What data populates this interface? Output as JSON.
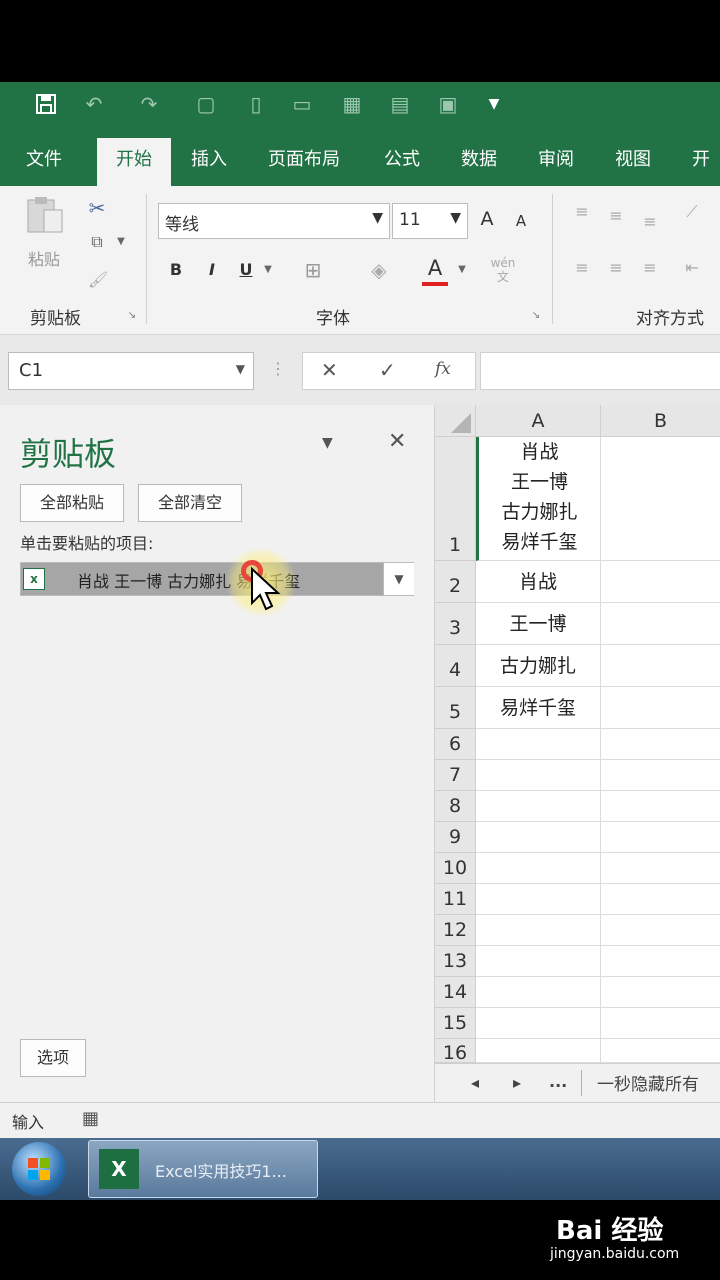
{
  "quick_access": {
    "icons": [
      "save-icon",
      "undo-icon",
      "redo-icon",
      "print-preview-icon",
      "new-doc-icon",
      "comment-icon",
      "table-icon",
      "form-icon",
      "macro-icon",
      "customize-icon"
    ]
  },
  "menu": {
    "tabs": [
      "文件",
      "开始",
      "插入",
      "页面布局",
      "公式",
      "数据",
      "审阅",
      "视图",
      "开发"
    ],
    "active": "开始"
  },
  "ribbon": {
    "clipboard_group": {
      "paste_label": "粘贴",
      "label": "剪贴板"
    },
    "font_group": {
      "font_name": "等线",
      "font_size": "11",
      "grow": "A",
      "shrink": "A",
      "bold": "B",
      "italic": "I",
      "underline": "U",
      "font_color": "A",
      "phonetic": "wén 文",
      "label": "字体"
    },
    "align_group": {
      "label": "对齐方式"
    }
  },
  "formula_bar": {
    "name_box": "C1",
    "cancel": "✕",
    "enter": "✓",
    "fx": "fx",
    "value": ""
  },
  "clipboard_pane": {
    "title": "剪贴板",
    "paste_all": "全部粘贴",
    "clear_all": "全部清空",
    "instruction": "单击要粘贴的项目:",
    "item_text": "肖战 王一博 古力娜扎 易烊千玺",
    "options": "选项"
  },
  "grid": {
    "col_a": "A",
    "col_b": "B",
    "row1_lines": [
      "肖战",
      "王一博",
      "古力娜扎",
      "易烊千玺"
    ],
    "rows": [
      {
        "n": "1",
        "a": ""
      },
      {
        "n": "2",
        "a": "肖战"
      },
      {
        "n": "3",
        "a": "王一博"
      },
      {
        "n": "4",
        "a": "古力娜扎"
      },
      {
        "n": "5",
        "a": "易烊千玺"
      },
      {
        "n": "6",
        "a": ""
      },
      {
        "n": "7",
        "a": ""
      },
      {
        "n": "8",
        "a": ""
      },
      {
        "n": "9",
        "a": ""
      },
      {
        "n": "10",
        "a": ""
      },
      {
        "n": "11",
        "a": ""
      },
      {
        "n": "12",
        "a": ""
      },
      {
        "n": "13",
        "a": ""
      },
      {
        "n": "14",
        "a": ""
      },
      {
        "n": "15",
        "a": ""
      },
      {
        "n": "16",
        "a": ""
      }
    ],
    "sheet_nav": {
      "prev": "◂",
      "next": "▸",
      "more": "...",
      "sheet_name": "一秒隐藏所有"
    }
  },
  "status": {
    "mode": "输入"
  },
  "taskbar": {
    "app_label": "Excel实用技巧1..."
  },
  "watermark": {
    "brand": "Bai 经验",
    "url": "jingyan.baidu.com"
  },
  "colors": {
    "excel_green": "#217346"
  }
}
